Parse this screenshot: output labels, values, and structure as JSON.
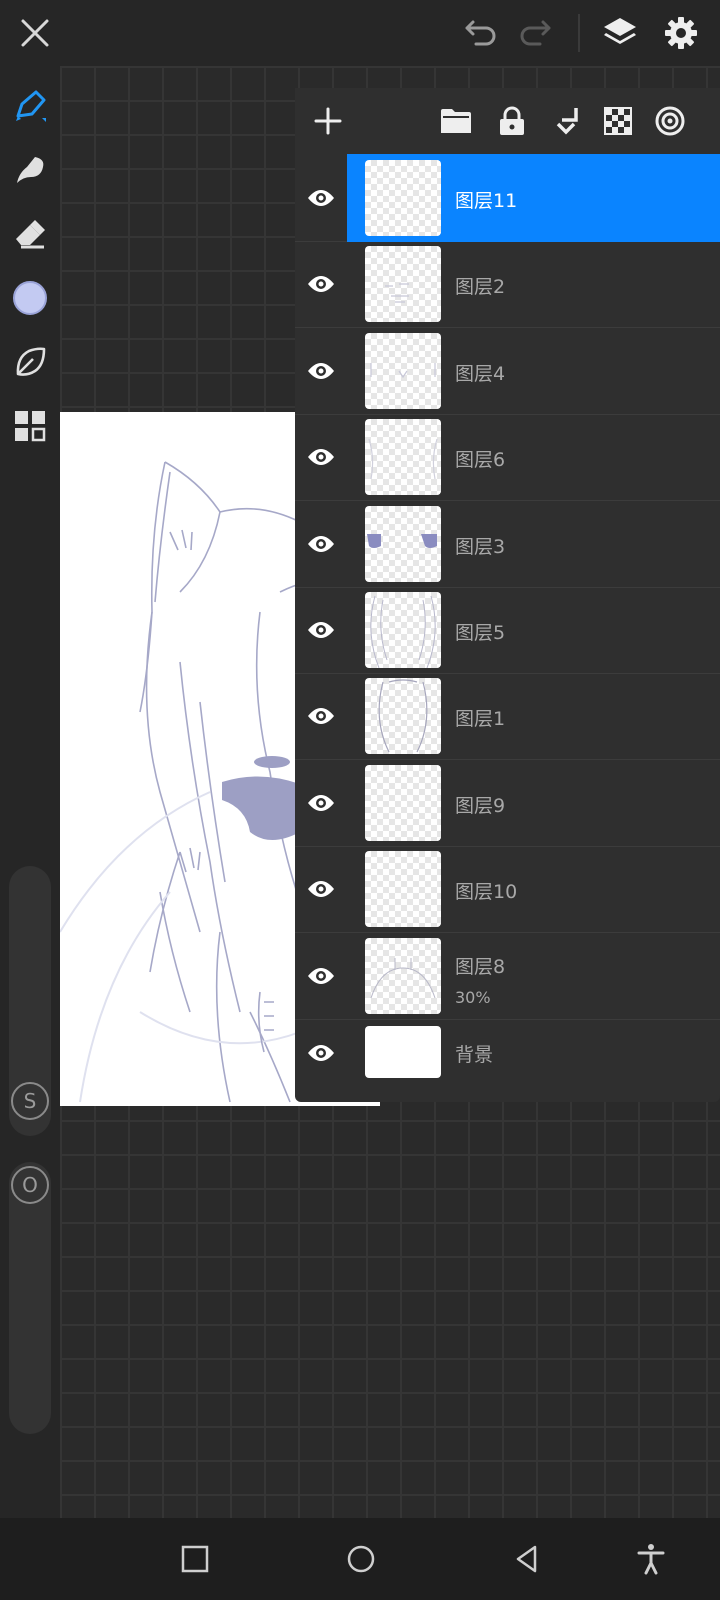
{
  "toolbar": {
    "close_icon": "close-icon",
    "undo_icon": "undo-icon",
    "redo_icon": "redo-icon",
    "layers_icon": "layers-icon",
    "settings_icon": "gear-icon"
  },
  "left_tools": [
    {
      "name": "brush",
      "icon": "pen-icon",
      "active": true
    },
    {
      "name": "smudge",
      "icon": "smudge-icon"
    },
    {
      "name": "eraser",
      "icon": "eraser-icon"
    },
    {
      "name": "color",
      "icon": "color-swatch",
      "color": "#c3caf2"
    },
    {
      "name": "leaf",
      "icon": "leaf-icon"
    },
    {
      "name": "gallery",
      "icon": "grid-icon"
    }
  ],
  "sliders": {
    "size_label": "S",
    "opacity_label": "O"
  },
  "layer_panel": {
    "actions": [
      "add-icon",
      "folder-icon",
      "lock-icon",
      "merge-down-icon",
      "checker-icon",
      "target-icon"
    ],
    "layers": [
      {
        "name": "图层11",
        "selected": true,
        "opacity": ""
      },
      {
        "name": "图层2",
        "selected": false,
        "opacity": ""
      },
      {
        "name": "图层4",
        "selected": false,
        "opacity": ""
      },
      {
        "name": "图层6",
        "selected": false,
        "opacity": ""
      },
      {
        "name": "图层3",
        "selected": false,
        "opacity": ""
      },
      {
        "name": "图层5",
        "selected": false,
        "opacity": ""
      },
      {
        "name": "图层1",
        "selected": false,
        "opacity": ""
      },
      {
        "name": "图层9",
        "selected": false,
        "opacity": ""
      },
      {
        "name": "图层10",
        "selected": false,
        "opacity": ""
      },
      {
        "name": "图层8",
        "selected": false,
        "opacity": "30%"
      },
      {
        "name": "背景",
        "selected": false,
        "opacity": ""
      }
    ]
  },
  "colors": {
    "accent": "#0a84ff",
    "current_color": "#c3caf2"
  },
  "navbar": {
    "icons": [
      "recent-apps-icon",
      "home-icon",
      "back-icon",
      "accessibility-icon"
    ]
  }
}
